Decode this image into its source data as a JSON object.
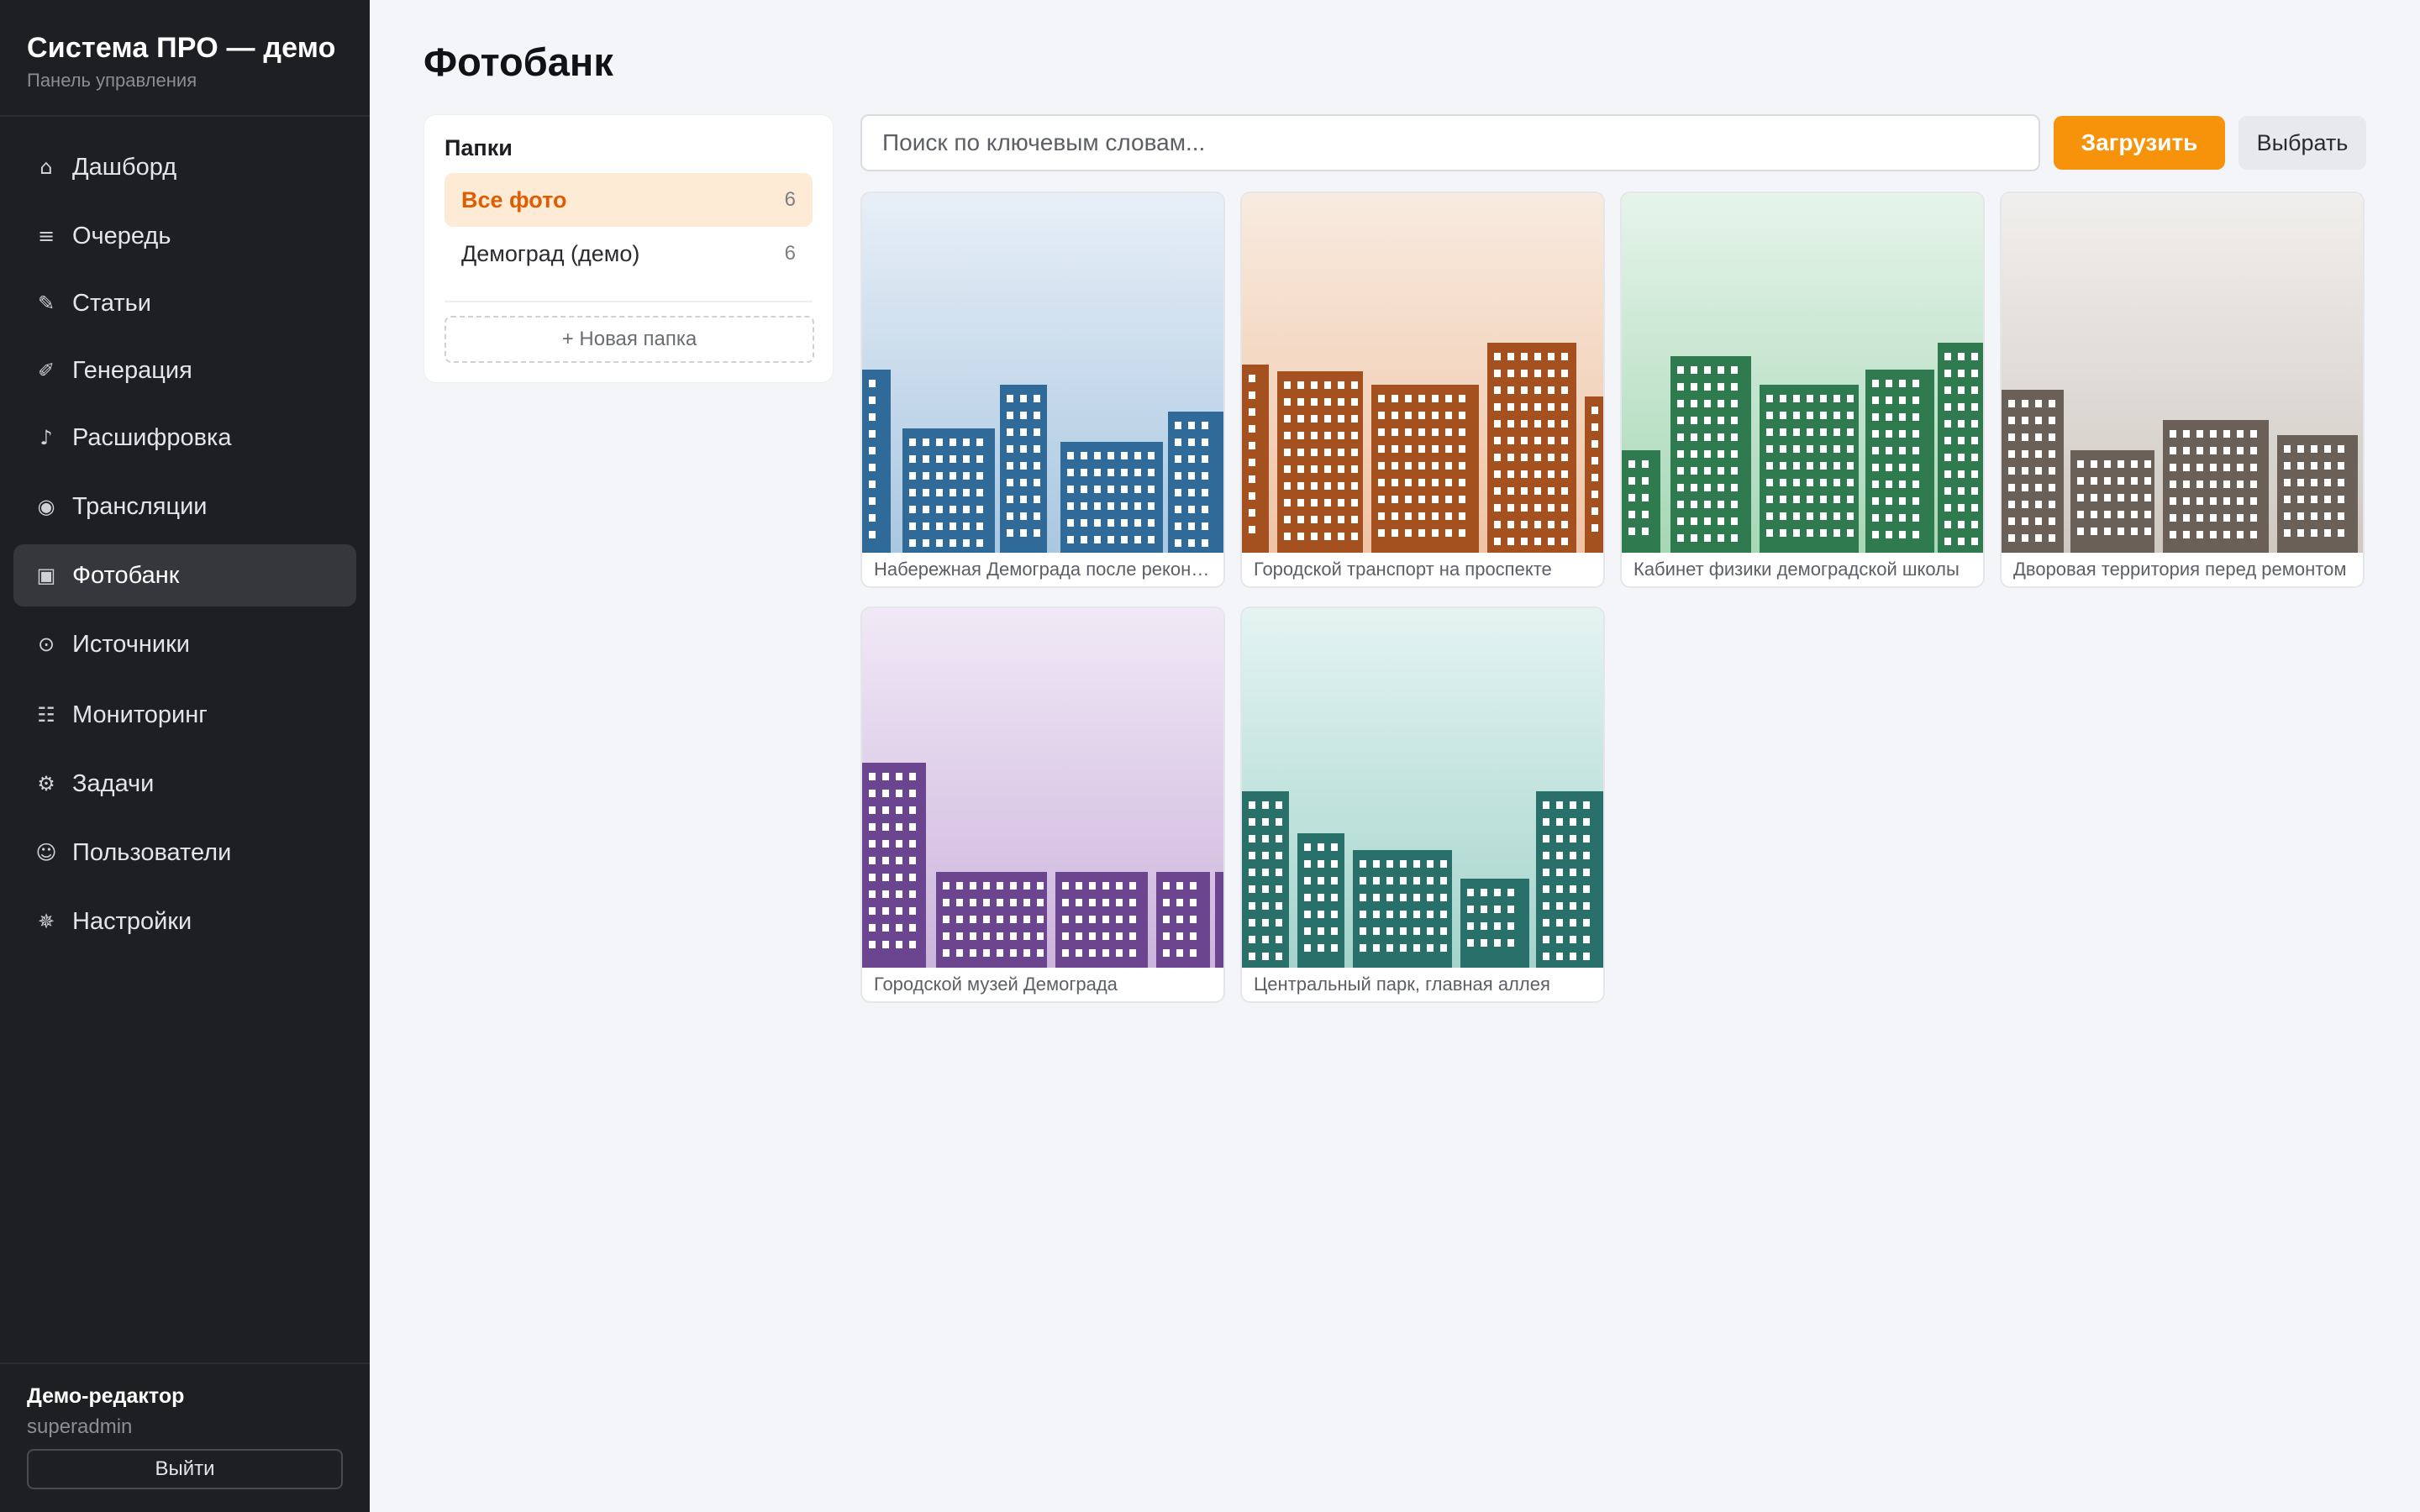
{
  "app": {
    "title": "Система ПРО — демо",
    "subtitle": "Панель управления"
  },
  "sidebar": {
    "items": [
      {
        "label": "Дашборд",
        "icon": "home-icon",
        "glyph": "⌂"
      },
      {
        "label": "Очередь",
        "icon": "list-icon",
        "glyph": "≡"
      },
      {
        "label": "Статьи",
        "icon": "pencil-icon",
        "glyph": "✎"
      },
      {
        "label": "Генерация",
        "icon": "pen-icon",
        "glyph": "✐"
      },
      {
        "label": "Расшифровка",
        "icon": "music-note-icon",
        "glyph": "♪"
      },
      {
        "label": "Трансляции",
        "icon": "broadcast-icon",
        "glyph": "◉"
      },
      {
        "label": "Фотобанк",
        "icon": "photo-icon",
        "glyph": "▣",
        "active": true
      },
      {
        "label": "Источники",
        "icon": "target-icon",
        "glyph": "⊙"
      },
      {
        "label": "Мониторинг",
        "icon": "monitoring-icon",
        "glyph": "☷"
      },
      {
        "label": "Задачи",
        "icon": "gear-icon",
        "glyph": "⚙"
      },
      {
        "label": "Пользователи",
        "icon": "user-icon",
        "glyph": "☺"
      },
      {
        "label": "Настройки",
        "icon": "settings-icon",
        "glyph": "✵"
      }
    ]
  },
  "user": {
    "name": "Демо-редактор",
    "role": "superadmin",
    "logout_label": "Выйти"
  },
  "main": {
    "title": "Фотобанк"
  },
  "folders": {
    "title": "Папки",
    "items": [
      {
        "label": "Все фото",
        "count": "6",
        "active": true
      },
      {
        "label": "Демоград (демо)",
        "count": "6"
      }
    ],
    "new_folder_label": "+ Новая папка"
  },
  "toolbar": {
    "search_placeholder": "Поиск по ключевым словам...",
    "search_value": "",
    "upload_label": "Загрузить",
    "select_label": "Выбрать"
  },
  "photos": [
    {
      "caption": "Набережная Демограда после реконструкции",
      "color": "#2f6a98",
      "sky_top": "#e8eff7",
      "sky_bottom": "#a9c7e0"
    },
    {
      "caption": "Городской транспорт на проспекте",
      "color": "#a5501f",
      "sky_top": "#f8ebe0",
      "sky_bottom": "#efc3a4"
    },
    {
      "caption": "Кабинет физики демоградской школы",
      "color": "#2f7a4e",
      "sky_top": "#e6f4ea",
      "sky_bottom": "#a6d7b5"
    },
    {
      "caption": "Дворовая территория перед ремонтом",
      "color": "#6a6058",
      "sky_top": "#f1efed",
      "sky_bottom": "#cfc8c1"
    },
    {
      "caption": "Городской музей Демограда",
      "color": "#6b4590",
      "sky_top": "#f1e9f6",
      "sky_bottom": "#ccb4dc"
    },
    {
      "caption": "Центральный парк, главная аллея",
      "color": "#2a706a",
      "sky_top": "#e4f4f1",
      "sky_bottom": "#a4d3cc"
    }
  ]
}
